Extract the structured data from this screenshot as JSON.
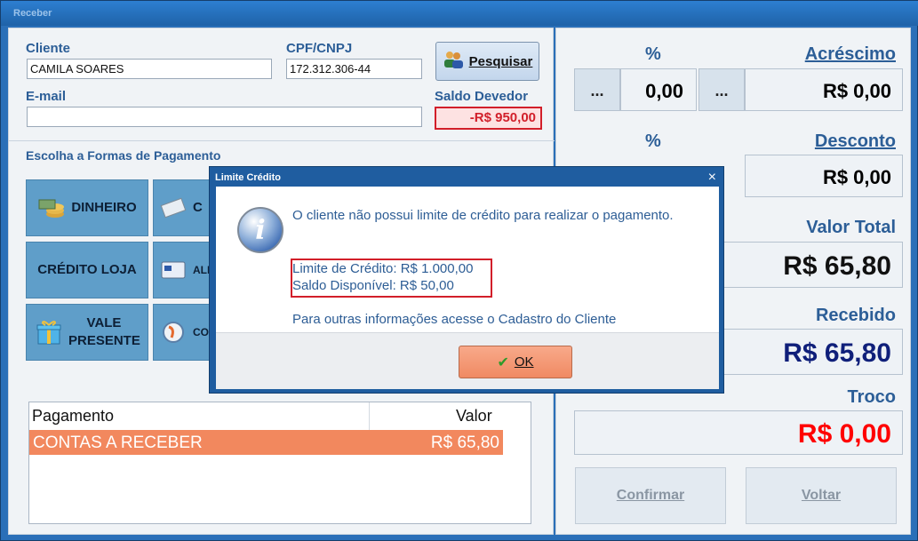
{
  "window": {
    "title": "Receber"
  },
  "cliente": {
    "label": "Cliente",
    "value": "CAMILA SOARES",
    "cpf_label": "CPF/CNPJ",
    "cpf_value": "172.312.306-44",
    "email_label": "E-mail",
    "email_value": "",
    "search_label": "Pesquisar",
    "saldo_label": "Saldo Devedor",
    "saldo_value": "-R$ 950,00"
  },
  "pagamento": {
    "section_label": "Escolha a Formas de Pagamento",
    "buttons": [
      {
        "label": "DINHEIRO",
        "icon": "coins-icon"
      },
      {
        "label": "C",
        "icon": "cheque-icon"
      },
      {
        "label": "CRÉDITO LOJA",
        "icon": ""
      },
      {
        "label": "ALI",
        "icon": "card-icon"
      },
      {
        "label": "VALE PRESENTE",
        "icon": "gift-icon"
      },
      {
        "label": "CO",
        "icon": "globe-icon"
      }
    ],
    "table": {
      "headers": [
        "Pagamento",
        "Valor"
      ],
      "rows": [
        {
          "pagamento": "CONTAS A RECEBER",
          "valor": "R$ 65,80"
        }
      ]
    }
  },
  "resumo": {
    "pct_label": "%",
    "acrescimo_label": "Acréscimo",
    "acrescimo_pct": "0,00",
    "acrescimo_value": "R$ 0,00",
    "dots": "...",
    "desconto_pct_label": "%",
    "desconto_label": "Desconto",
    "desconto_value": "R$ 0,00",
    "valor_total_label": "Valor Total",
    "valor_total": "R$ 65,80",
    "recebido_label": "Recebido",
    "recebido": "R$ 65,80",
    "troco_label": "Troco",
    "troco": "R$ 0,00",
    "confirmar_label": "Confirmar",
    "voltar_label": "Voltar"
  },
  "dialog": {
    "title": "Limite Crédito",
    "close": "×",
    "message": "O cliente não possui limite de crédito para realizar o pagamento.",
    "limite": "Limite de Crédito: R$ 1.000,00",
    "saldo": "Saldo Disponível: R$ 50,00",
    "info": "Para outras informações acesse o Cadastro do Cliente",
    "ok_label": "OK"
  },
  "colors": {
    "accent": "#2c5e97",
    "alert": "#d21f2a",
    "selected_row": "#f2885e",
    "navy": "#0f1f7a"
  }
}
